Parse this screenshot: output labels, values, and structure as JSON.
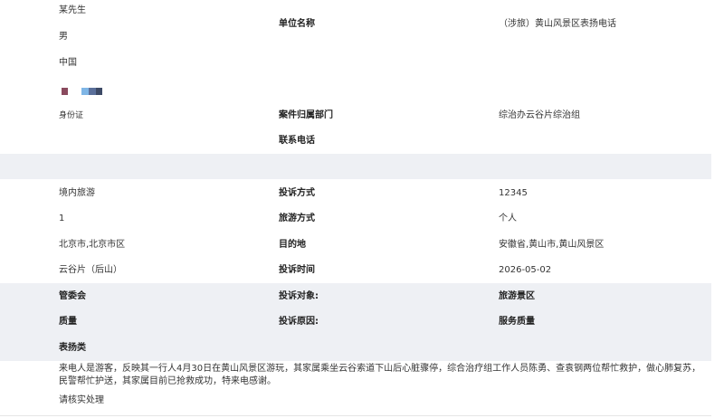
{
  "caller": {
    "name": "某先生",
    "gender": "男",
    "nationality": "中国",
    "id_type": "身份证"
  },
  "org": {
    "unit_label": "单位名称",
    "unit_value": "（涉旅）黄山风景区表扬电话",
    "dept_label": "案件归属部门",
    "dept_value": "综治办云谷片综治组",
    "phone_label": "联系电话",
    "phone_value": ""
  },
  "trip": {
    "travel_type": "境内旅游",
    "people_count": "1",
    "origin": "北京市,北京市区",
    "area": "云谷片（后山）",
    "complaint_method_label": "投诉方式",
    "complaint_method_value": "12345",
    "travel_method_label": "旅游方式",
    "travel_method_value": "个人",
    "destination_label": "目的地",
    "destination_value": "安徽省,黄山市,黄山风景区",
    "complaint_time_label": "投诉时间",
    "complaint_time_value": "2026-05-02"
  },
  "category": {
    "committee": "管委会",
    "quality": "质量",
    "praise": "表扬类",
    "object_label": "投诉对象:",
    "object_value": "旅游景区",
    "reason_label": "投诉原因:",
    "reason_value": "服务质量"
  },
  "description": "来电人是游客，反映其一行人4月30日在黄山风景区游玩，其家属乘坐云谷索道下山后心脏骤停，综合治疗组工作人员陈勇、查袁钢两位帮忙救护，做心肺复苏，民警帮忙护送，其家属目前已抢救成功，特来电感谢。",
  "instruction": "请核实处理",
  "colors": {
    "band": "#eef0f4",
    "text": "#333333",
    "mosaic": [
      "#8a4a5e",
      "#7fb6e6",
      "#5a6f9a",
      "#3d4a66"
    ]
  }
}
